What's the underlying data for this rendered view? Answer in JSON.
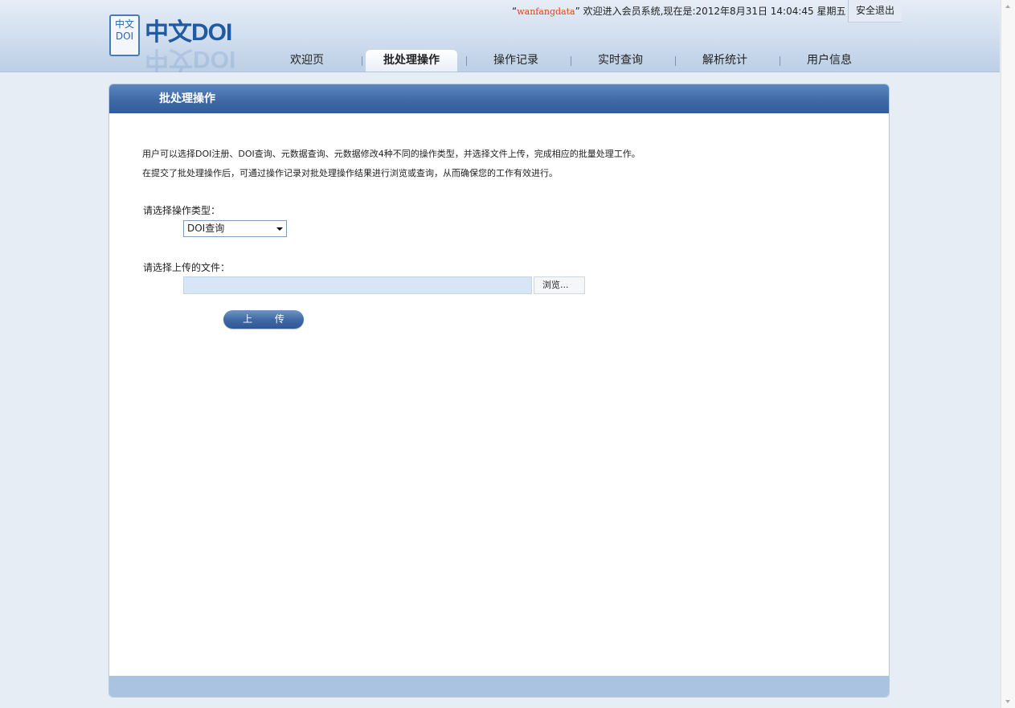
{
  "header": {
    "logo_seal": "中文 DOI",
    "logo_text": "中文DOI",
    "welcome_open_quote": "“",
    "welcome_user": "wanfangdata",
    "welcome_rest": "” 欢迎进入会员系统,现在是:2012年8月31日 14:04:45 星期五",
    "logout_label": "安全退出"
  },
  "nav": {
    "tabs": [
      {
        "label": "欢迎页",
        "active": false
      },
      {
        "label": "批处理操作",
        "active": true
      },
      {
        "label": "操作记录",
        "active": false
      },
      {
        "label": "实时查询",
        "active": false
      },
      {
        "label": "解析统计",
        "active": false
      },
      {
        "label": "用户信息",
        "active": false
      }
    ]
  },
  "panel": {
    "title": "批处理操作",
    "desc_line1": "用户可以选择DOI注册、DOI查询、元数据查询、元数据修改4种不同的操作类型，并选择文件上传，完成相应的批量处理工作。",
    "desc_line2": "在提交了批处理操作后，可通过操作记录对批处理操作结果进行浏览或查询，从而确保您的工作有效进行。",
    "op_type_label": "请选择操作类型：",
    "op_type_value": "DOI查询",
    "file_label": "请选择上传的文件：",
    "file_value": "",
    "browse_label": "浏览...",
    "upload_label": "上 传"
  },
  "colors": {
    "panel_header": "#3f6aa5",
    "footer_bar": "#a9c3e0",
    "username": "#e0401a",
    "file_field_bg": "#d7e6f7"
  }
}
